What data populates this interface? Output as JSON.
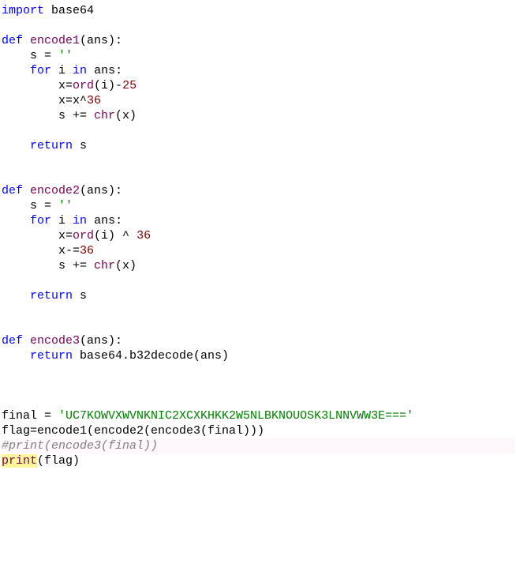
{
  "code": {
    "ln_import": {
      "kw_import": "import",
      "mod": "base64"
    },
    "fn1": {
      "kw_def": "def",
      "name": "encode1",
      "params": "(ans):",
      "l1_s": "s = ",
      "l1_q": "''",
      "l2_for": "for",
      "l2_rest": " i ",
      "l2_in": "in",
      "l2_tail": " ans:",
      "l3_a": "x=",
      "l3_fn": "ord",
      "l3_b": "(i)-",
      "l3_n": "25",
      "l4_a": "x=x^",
      "l4_n": "36",
      "l5_a": "s += ",
      "l5_fn": "chr",
      "l5_b": "(x)",
      "ret": "return",
      "ret_tail": " s"
    },
    "fn2": {
      "kw_def": "def",
      "name": "encode2",
      "params": "(ans):",
      "l1_s": "s = ",
      "l1_q": "''",
      "l2_for": "for",
      "l2_rest": " i ",
      "l2_in": "in",
      "l2_tail": " ans:",
      "l3_a": "x=",
      "l3_fn": "ord",
      "l3_b": "(i) ^ ",
      "l3_n": "36",
      "l4_a": "x-=",
      "l4_n": "36",
      "l5_a": "s += ",
      "l5_fn": "chr",
      "l5_b": "(x)",
      "ret": "return",
      "ret_tail": " s"
    },
    "fn3": {
      "kw_def": "def",
      "name": "encode3",
      "params": "(ans):",
      "ret": "return",
      "ret_tail": " base64.b32decode(ans)"
    },
    "final_line": {
      "a": "final = ",
      "s": "'UC7KOWVXWVNKNIC2XCXKHKK2W5NLBKNOUOSK3LNNVWW3E==='"
    },
    "flag_line": "flag=encode1(encode2(encode3(final)))",
    "comment_line": "#print(encode3(final))",
    "print_line": {
      "fn": "print",
      "rest": "(flag)"
    }
  }
}
